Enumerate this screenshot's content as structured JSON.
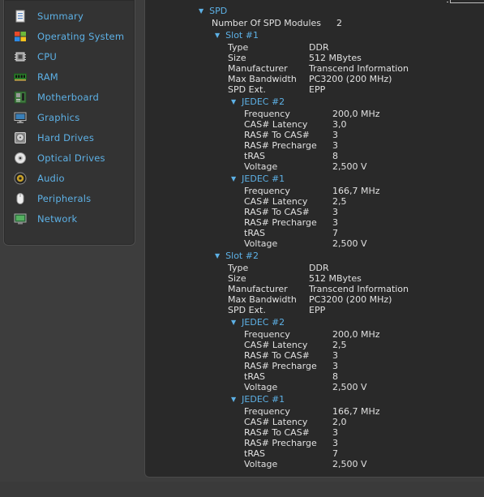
{
  "sidebar": {
    "items": [
      {
        "label": "Summary",
        "icon": "summary-icon"
      },
      {
        "label": "Operating System",
        "icon": "windows-logo-icon"
      },
      {
        "label": "CPU",
        "icon": "cpu-chip-icon"
      },
      {
        "label": "RAM",
        "icon": "ram-module-icon"
      },
      {
        "label": "Motherboard",
        "icon": "motherboard-icon"
      },
      {
        "label": "Graphics",
        "icon": "monitor-icon"
      },
      {
        "label": "Hard Drives",
        "icon": "hard-drive-icon"
      },
      {
        "label": "Optical Drives",
        "icon": "optical-disc-icon"
      },
      {
        "label": "Audio",
        "icon": "speaker-icon"
      },
      {
        "label": "Peripherals",
        "icon": "mouse-icon"
      },
      {
        "label": "Network",
        "icon": "network-icon"
      }
    ]
  },
  "spd": {
    "title": "SPD",
    "modules_label": "Number Of SPD Modules",
    "modules_value": "2",
    "slots": [
      {
        "title": "Slot #1",
        "props": [
          {
            "k": "Type",
            "v": "DDR"
          },
          {
            "k": "Size",
            "v": "512 MBytes"
          },
          {
            "k": "Manufacturer",
            "v": "Transcend Information"
          },
          {
            "k": "Max Bandwidth",
            "v": "PC3200 (200 MHz)"
          },
          {
            "k": "SPD Ext.",
            "v": "EPP"
          }
        ],
        "jedec": [
          {
            "title": "JEDEC #2",
            "props": [
              {
                "k": "Frequency",
                "v": "200,0 MHz"
              },
              {
                "k": "CAS# Latency",
                "v": "3,0"
              },
              {
                "k": "RAS# To CAS#",
                "v": "3"
              },
              {
                "k": "RAS# Precharge",
                "v": "3"
              },
              {
                "k": "tRAS",
                "v": "8"
              },
              {
                "k": "Voltage",
                "v": "2,500 V"
              }
            ]
          },
          {
            "title": "JEDEC #1",
            "props": [
              {
                "k": "Frequency",
                "v": "166,7 MHz"
              },
              {
                "k": "CAS# Latency",
                "v": "2,5"
              },
              {
                "k": "RAS# To CAS#",
                "v": "3"
              },
              {
                "k": "RAS# Precharge",
                "v": "3"
              },
              {
                "k": "tRAS",
                "v": "7"
              },
              {
                "k": "Voltage",
                "v": "2,500 V"
              }
            ]
          }
        ]
      },
      {
        "title": "Slot #2",
        "props": [
          {
            "k": "Type",
            "v": "DDR"
          },
          {
            "k": "Size",
            "v": "512 MBytes"
          },
          {
            "k": "Manufacturer",
            "v": "Transcend Information"
          },
          {
            "k": "Max Bandwidth",
            "v": "PC3200 (200 MHz)"
          },
          {
            "k": "SPD Ext.",
            "v": "EPP"
          }
        ],
        "jedec": [
          {
            "title": "JEDEC #2",
            "props": [
              {
                "k": "Frequency",
                "v": "200,0 MHz"
              },
              {
                "k": "CAS# Latency",
                "v": "2,5"
              },
              {
                "k": "RAS# To CAS#",
                "v": "3"
              },
              {
                "k": "RAS# Precharge",
                "v": "3"
              },
              {
                "k": "tRAS",
                "v": "8"
              },
              {
                "k": "Voltage",
                "v": "2,500 V"
              }
            ]
          },
          {
            "title": "JEDEC #1",
            "props": [
              {
                "k": "Frequency",
                "v": "166,7 MHz"
              },
              {
                "k": "CAS# Latency",
                "v": "2,0"
              },
              {
                "k": "RAS# To CAS#",
                "v": "3"
              },
              {
                "k": "RAS# Precharge",
                "v": "3"
              },
              {
                "k": "tRAS",
                "v": "7"
              },
              {
                "k": "Voltage",
                "v": "2,500 V"
              }
            ]
          }
        ]
      }
    ]
  },
  "colors": {
    "accent": "#5db1e6",
    "text": "#e0e0e0",
    "panel_bg": "#292929",
    "sidebar_bg": "#333333"
  }
}
